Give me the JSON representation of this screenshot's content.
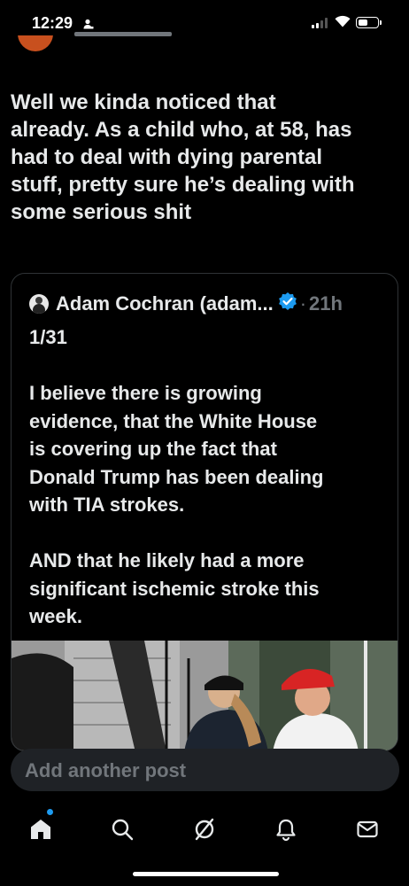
{
  "status_bar": {
    "time": "12:29"
  },
  "post": {
    "text": "Well we kinda noticed that\nalready.  As a child who, at 58, has\nhad to deal with dying parental\nstuff, pretty sure he’s dealing with\nsome serious shit"
  },
  "quote": {
    "author": "Adam Cochran (adam...",
    "separator": "·",
    "time": "21h",
    "text": "1/31\n\nI believe there is growing\nevidence, that the White House\nis covering up the fact that\nDonald Trump has been dealing\nwith TIA strokes.\n\nAND that he likely had a more\nsignificant ischemic stroke this\nweek."
  },
  "composer": {
    "placeholder": "Add another post"
  },
  "nav": {
    "items": [
      "home-icon",
      "search-icon",
      "grok-icon",
      "notifications-icon",
      "messages-icon"
    ]
  },
  "colors": {
    "accent": "#1d9bf0",
    "background": "#000000",
    "muted": "#71767b"
  }
}
